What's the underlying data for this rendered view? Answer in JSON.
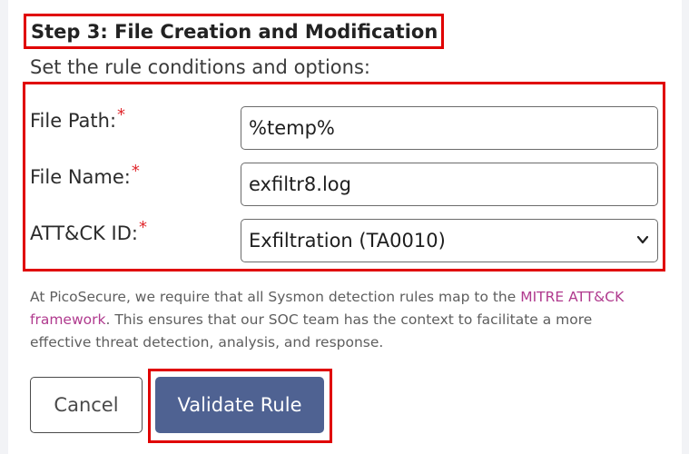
{
  "step": {
    "title": "Step 3: File Creation and Modification",
    "subtitle": "Set the rule conditions and options:"
  },
  "fields": {
    "file_path": {
      "label": "File Path:",
      "required_mark": "*",
      "value": "%temp%"
    },
    "file_name": {
      "label": "File Name:",
      "required_mark": "*",
      "value": "exfiltr8.log"
    },
    "attck_id": {
      "label": "ATT&CK ID:",
      "required_mark": "*",
      "value": "Exfiltration (TA0010)"
    }
  },
  "info": {
    "text_before": "At PicoSecure, we require that all Sysmon detection rules map to the ",
    "link_text": "MITRE ATT&CK framework",
    "text_after": ". This ensures that our SOC team has the context to facilitate a more effective threat detection, analysis, and response."
  },
  "buttons": {
    "cancel_label": "Cancel",
    "validate_label": "Validate Rule"
  },
  "colors": {
    "highlight": "#e00000",
    "primary_button": "#4f6292",
    "link": "#b03a8e",
    "required": "#e0272c"
  },
  "icons": {
    "select_arrow": "chevron-down-icon"
  }
}
